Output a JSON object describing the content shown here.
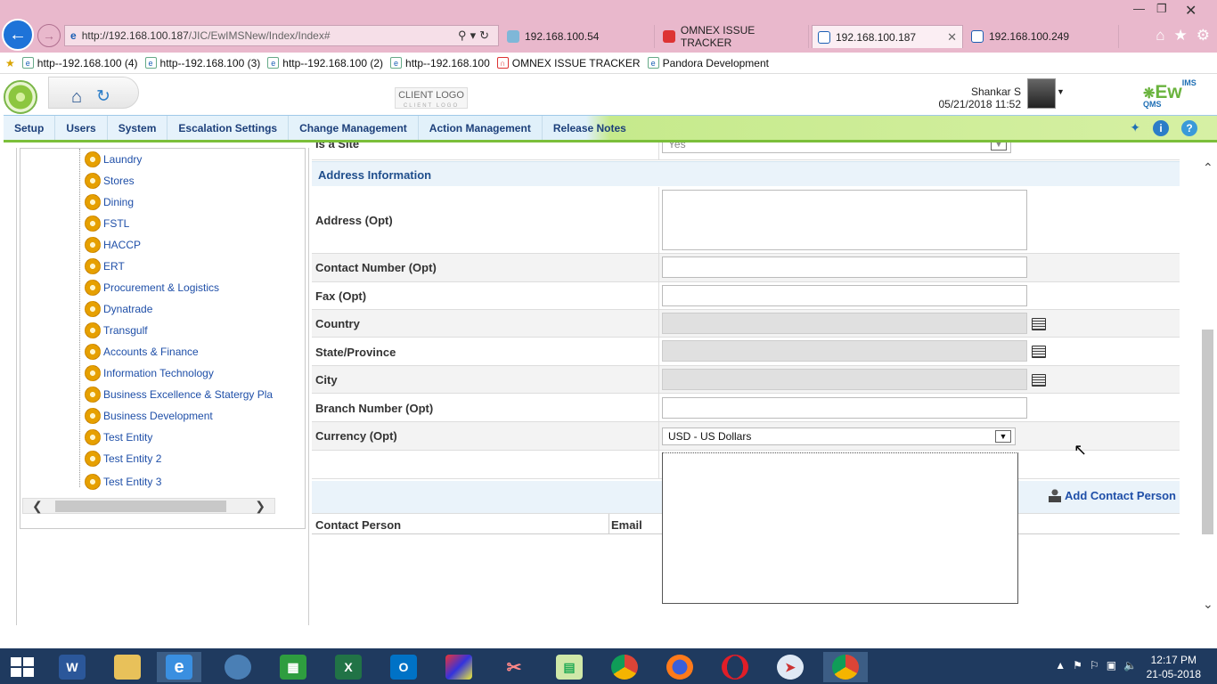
{
  "browser": {
    "url_host": "http://192.168.100.187",
    "url_path": "/JIC/EwIMSNew/Index/Index#",
    "tabs": [
      {
        "label": "192.168.100.54"
      },
      {
        "label": "OMNEX ISSUE TRACKER"
      },
      {
        "label": "192.168.100.187"
      },
      {
        "label": "192.168.100.249"
      }
    ],
    "favorites": [
      {
        "label": "http--192.168.100 (4)"
      },
      {
        "label": "http--192.168.100 (3)"
      },
      {
        "label": "http--192.168.100 (2)"
      },
      {
        "label": "http--192.168.100"
      },
      {
        "label": "OMNEX ISSUE TRACKER"
      },
      {
        "label": "Pandora Development"
      }
    ]
  },
  "header": {
    "client_logo": "CLIENT LOGO",
    "client_logo_sub": "CLIENT LOGO",
    "user_name": "Shankar S",
    "datetime": "05/21/2018 11:52",
    "brand": "Ew",
    "brand_sup": "IMS",
    "brand_tail": "QMS"
  },
  "menu": [
    {
      "label": "Setup"
    },
    {
      "label": "Users"
    },
    {
      "label": "System"
    },
    {
      "label": "Escalation Settings"
    },
    {
      "label": "Change Management"
    },
    {
      "label": "Action Management"
    },
    {
      "label": "Release Notes"
    }
  ],
  "tree": [
    {
      "label": "Laundry"
    },
    {
      "label": "Stores"
    },
    {
      "label": "Dining"
    },
    {
      "label": "FSTL"
    },
    {
      "label": "HACCP"
    },
    {
      "label": "ERT"
    },
    {
      "label": "Procurement & Logistics"
    },
    {
      "label": "Dynatrade"
    },
    {
      "label": "Transgulf"
    },
    {
      "label": "Accounts & Finance"
    },
    {
      "label": "Information Technology"
    },
    {
      "label": "Business Excellence & Statergy Pla"
    },
    {
      "label": "Business Development"
    },
    {
      "label": "Test Entity"
    },
    {
      "label": "Test Entity 2"
    },
    {
      "label": "Test Entity 3"
    }
  ],
  "form": {
    "top_row_label": "Is a Site",
    "top_row_value": "Yes",
    "section_title": "Address Information",
    "fields": {
      "address": "Address (Opt)",
      "contact_number": "Contact Number (Opt)",
      "fax": "Fax (Opt)",
      "country": "Country",
      "state": "State/Province",
      "city": "City",
      "branch": "Branch Number (Opt)",
      "currency": "Currency (Opt)"
    },
    "currency_value": "USD - US Dollars",
    "add_contact": "Add Contact Person",
    "table_headers": {
      "contact_person": "Contact Person",
      "email": "Email"
    }
  },
  "taskbar": {
    "time": "12:17 PM",
    "date": "21-05-2018"
  }
}
